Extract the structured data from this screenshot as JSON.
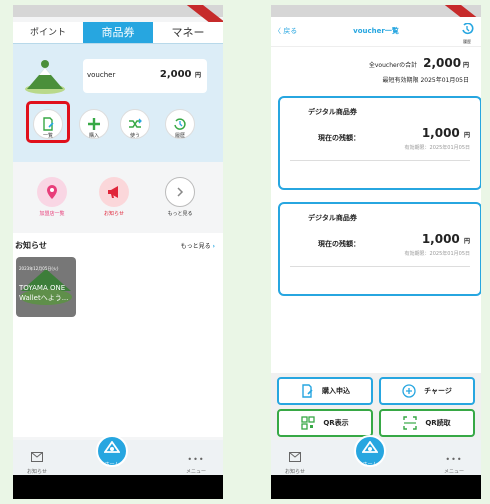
{
  "left": {
    "tabs": [
      {
        "label": "ポイント"
      },
      {
        "label": "商品券"
      },
      {
        "label": "マネー"
      }
    ],
    "balance": {
      "label": "voucher",
      "value": "2,000",
      "unit": "円"
    },
    "actions": [
      {
        "label": "一覧",
        "icon": "document-edit-icon"
      },
      {
        "label": "購入",
        "icon": "plus-icon"
      },
      {
        "label": "使う",
        "icon": "shuffle-icon"
      },
      {
        "label": "履歴",
        "icon": "history-icon"
      }
    ],
    "menu": [
      {
        "label": "加盟店一覧",
        "icon": "map-pin-icon"
      },
      {
        "label": "お知らせ",
        "icon": "megaphone-icon"
      },
      {
        "label": "もっと見る",
        "icon": "chevron-right-icon"
      }
    ],
    "news": {
      "title": "お知らせ",
      "more": "もっと見る",
      "chevron": "›",
      "card": {
        "date": "2023年12月05日(火)",
        "text": "TOYAMA ONE Walletへよう..."
      }
    },
    "nav": {
      "notices": "お知らせ",
      "home": "ホーム",
      "menu": "メニュー",
      "menu_dots": "•••"
    }
  },
  "right": {
    "header": {
      "back": "〈 戻る",
      "title": "voucher一覧",
      "history": "履歴"
    },
    "summary": {
      "total_label": "全voucherの合計",
      "total_value": "2,000",
      "total_unit": "円",
      "expiry_label": "最短有効期限",
      "expiry_value": "2025年01月05日"
    },
    "vouchers": [
      {
        "name": "デジタル商品券",
        "holding_label": "現在の残額：",
        "amount": "1,000",
        "unit": "円",
        "expiry": "有効期限：2025年01月05日"
      },
      {
        "name": "デジタル商品券",
        "holding_label": "現在の残額：",
        "amount": "1,000",
        "unit": "円",
        "expiry": "有効期限：2025年01月05日"
      }
    ],
    "actions": {
      "purchase": "購入申込",
      "charge": "チャージ",
      "qr_show": "QR表示",
      "qr_scan": "QR読取"
    },
    "nav": {
      "notices": "お知らせ",
      "home": "ホーム",
      "menu": "メニュー",
      "menu_dots": "•••"
    }
  },
  "colors": {
    "accent": "#27a6e0",
    "highlight": "#e0101b",
    "green": "#37a845",
    "pink": "#e83e7a",
    "red": "#e0263a"
  }
}
